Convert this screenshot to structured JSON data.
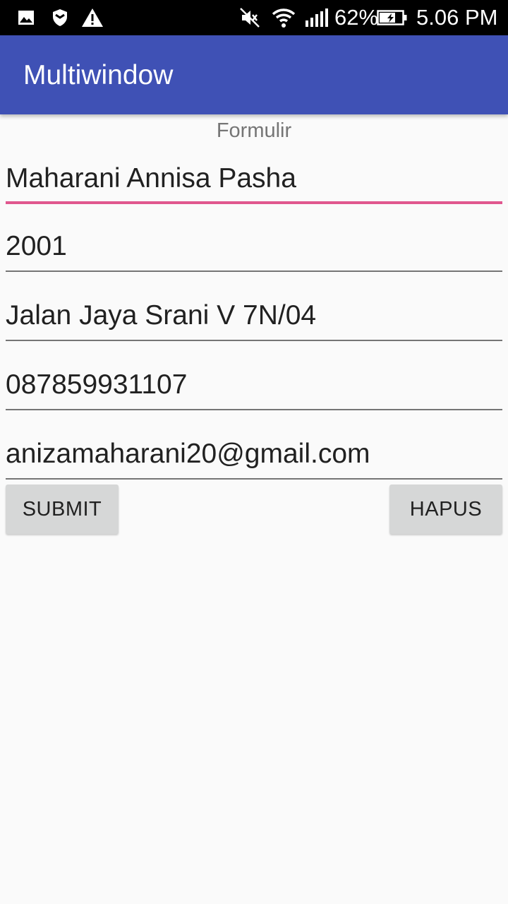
{
  "status_bar": {
    "battery_percent": "62%",
    "time": "5.06 PM",
    "icons": [
      "image-icon",
      "shield-icon",
      "warning-icon",
      "mute-icon",
      "wifi-icon",
      "signal-icon",
      "battery-charging-icon"
    ]
  },
  "app_bar": {
    "title": "Multiwindow",
    "color": "#3f51b5"
  },
  "form": {
    "heading": "Formulir",
    "fields": [
      {
        "value": "Maharani Annisa Pasha",
        "focused": true
      },
      {
        "value": "2001"
      },
      {
        "value": "Jalan Jaya Srani V 7N/04"
      },
      {
        "value": "087859931107"
      },
      {
        "value": "anizamaharani20@gmail.com"
      }
    ],
    "focus_color": "#e0578e",
    "submit_label": "SUBMIT",
    "clear_label": "HAPUS"
  }
}
